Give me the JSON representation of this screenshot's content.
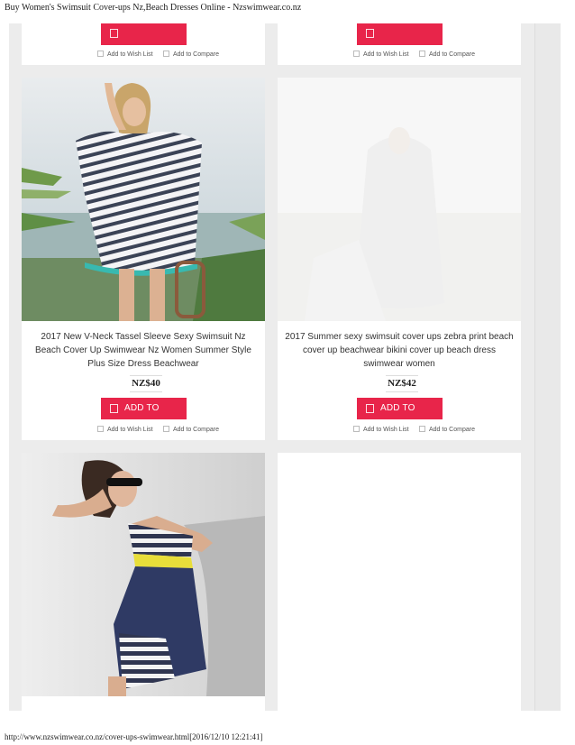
{
  "page": {
    "title": "Buy Women's Swimsuit Cover-ups Nz,Beach Dresses Online - Nzswimwear.co.nz",
    "footer": "http://www.nzswimwear.co.nz/cover-ups-swimwear.html[2016/12/10 12:21:41]"
  },
  "actions": {
    "add_to_cart": "ADD TO CART",
    "add_to_wishlist": "Add to Wish List",
    "add_to_compare": "Add to Compare"
  },
  "products": [
    {
      "name": "2017 New V-Neck Tassel Sleeve Sexy Swimsuit Nz Beach Cover Up Swimwear Nz Women Summer Style Plus Size Dress Beachwear",
      "price": "NZ$40"
    },
    {
      "name": "2017 Summer sexy swimsuit cover ups zebra print beach cover up beachwear bikini cover up beach dress swimwear women",
      "price": "NZ$42"
    }
  ],
  "colors": {
    "accent": "#e8254a",
    "panel": "#ececec"
  },
  "icons": [
    "cart-icon",
    "checkbox-icon"
  ]
}
